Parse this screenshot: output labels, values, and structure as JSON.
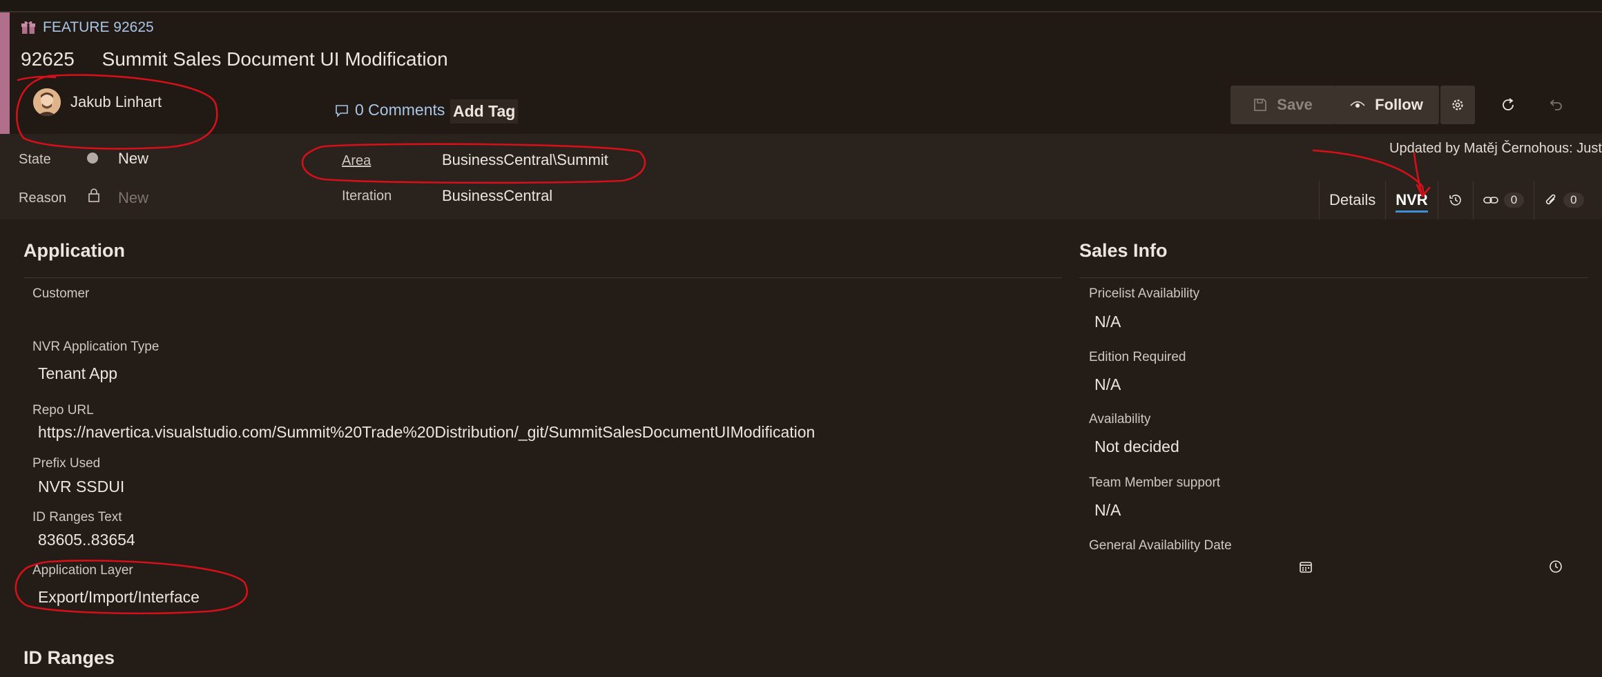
{
  "header": {
    "type_label": "FEATURE 92625",
    "id": "92625",
    "title": "Summit Sales Document UI Modification",
    "owner": "Jakub Linhart",
    "comments": "0 Comments",
    "add_tag": "Add Tag"
  },
  "toolbar": {
    "save": "Save",
    "follow": "Follow"
  },
  "fields": {
    "state_label": "State",
    "state_value": "New",
    "reason_label": "Reason",
    "reason_value": "New",
    "area_label": "Area",
    "area_value": "BusinessCentral\\Summit",
    "iteration_label": "Iteration",
    "iteration_value": "BusinessCentral"
  },
  "updated": "Updated by Matěj Černohous: Just n",
  "tabs": {
    "details": "Details",
    "nvr": "NVR",
    "links_count": "0",
    "attachments_count": "0"
  },
  "application": {
    "heading": "Application",
    "customer_label": "Customer",
    "customer_value": "",
    "app_type_label": "NVR Application Type",
    "app_type_value": "Tenant App",
    "repo_label": "Repo URL",
    "repo_value": "https://navertica.visualstudio.com/Summit%20Trade%20Distribution/_git/SummitSalesDocumentUIModification",
    "prefix_label": "Prefix Used",
    "prefix_value": "NVR SSDUI",
    "idranges_label": "ID Ranges Text",
    "idranges_value": "83605..83654",
    "layer_label": "Application Layer",
    "layer_value": "Export/Import/Interface"
  },
  "sales": {
    "heading": "Sales Info",
    "pricelist_label": "Pricelist Availability",
    "pricelist_value": "N/A",
    "edition_label": "Edition Required",
    "edition_value": "N/A",
    "availability_label": "Availability",
    "availability_value": "Not decided",
    "team_label": "Team Member support",
    "team_value": "N/A",
    "ga_label": "General Availability Date"
  },
  "id_ranges_heading": "ID Ranges",
  "colors": {
    "background": "#231c17",
    "accent_bar": "#b06f8a",
    "link": "#a9c6e6",
    "tab_underline": "#3d8fd6",
    "annotation": "#d4101a"
  }
}
